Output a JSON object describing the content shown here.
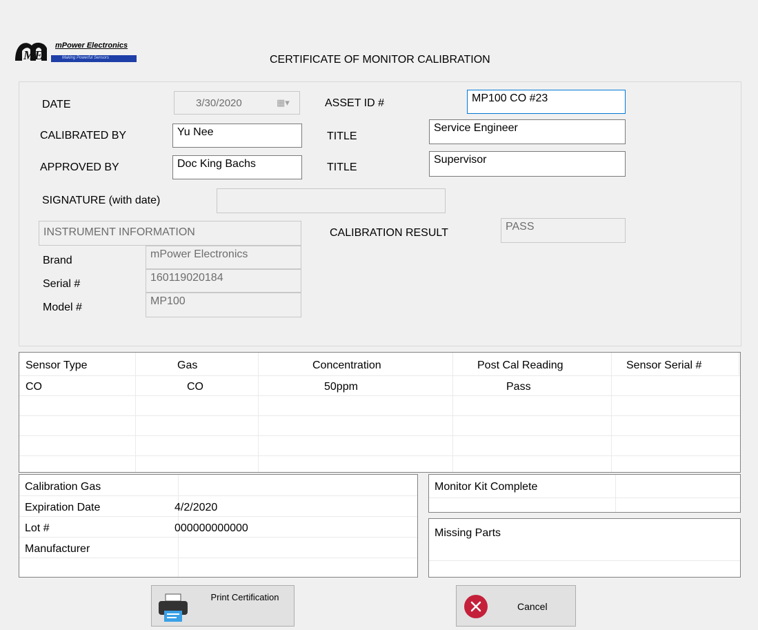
{
  "logo": {
    "brand": "mPower Electronics",
    "tagline": "Making Powerful Sensors"
  },
  "title": "CERTIFICATE OF MONITOR CALIBRATION",
  "form": {
    "date_label": "DATE",
    "date_value": "3/30/2020",
    "asset_label": "ASSET ID #",
    "asset_value": "MP100 CO #23",
    "calibrated_by_label": "CALIBRATED BY",
    "calibrated_by_value": "Yu Nee",
    "title1_label": "TITLE",
    "title1_value": "Service Engineer",
    "approved_by_label": "APPROVED BY",
    "approved_by_value": "Doc King Bachs",
    "title2_label": "TITLE",
    "title2_value": "Supervisor",
    "signature_label": "SIGNATURE (with date)",
    "signature_value": "",
    "instrument_header": "INSTRUMENT INFORMATION",
    "brand_label": "Brand",
    "brand_value": "mPower Electronics",
    "serial_label": "Serial #",
    "serial_value": "160119020184",
    "model_label": "Model #",
    "model_value": "MP100",
    "result_label": "CALIBRATION RESULT",
    "result_value": "PASS"
  },
  "sensor_table": {
    "headers": [
      "Sensor Type",
      "Gas",
      "Concentration",
      "Post Cal Reading",
      "Sensor Serial #"
    ],
    "rows": [
      [
        "CO",
        "CO",
        "50ppm",
        "Pass",
        ""
      ]
    ]
  },
  "cal_gas_table": {
    "rows": [
      [
        "Calibration Gas",
        ""
      ],
      [
        "Expiration Date",
        "4/2/2020"
      ],
      [
        "Lot #",
        "000000000000"
      ],
      [
        "Manufacturer",
        ""
      ]
    ]
  },
  "monitor_kit": {
    "label": "Monitor Kit Complete",
    "value": ""
  },
  "missing_parts": {
    "label": "Missing Parts"
  },
  "buttons": {
    "print": "Print Certification",
    "cancel": "Cancel"
  },
  "colors": {
    "accent_focus": "#0078d7",
    "logo_blue": "#1f3fa8",
    "cancel_red": "#c4203a"
  }
}
